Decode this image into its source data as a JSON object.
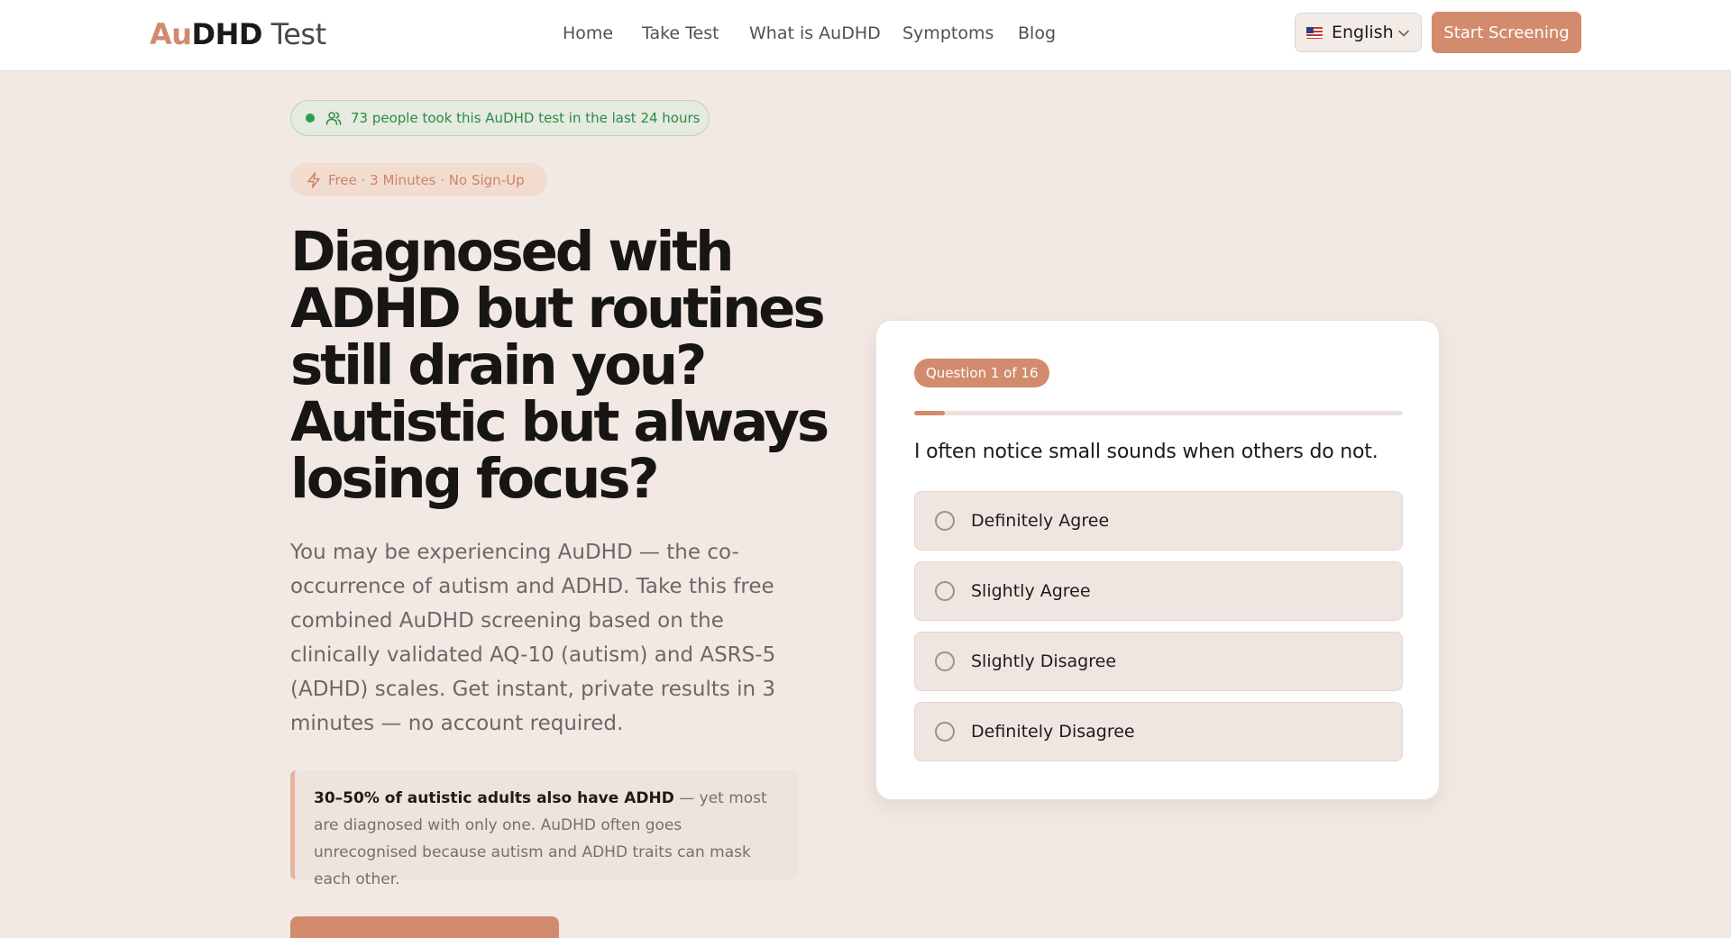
{
  "header": {
    "logo": {
      "part1": "Au",
      "part2": "DHD",
      "part3": "Test"
    },
    "nav": [
      "Home",
      "Take Test",
      "What is AuDHD",
      "Symptoms",
      "Blog"
    ],
    "language": {
      "label": "English",
      "flag_icon": "us-flag-icon"
    },
    "cta_label": "Start Screening"
  },
  "hero": {
    "live_badge": "73 people took this AuDHD test in the last 24 hours",
    "feature_badge": "Free · 3 Minutes · No Sign-Up",
    "title": "Diagnosed with ADHD but routines still drain you? Autistic but always losing focus?",
    "description": "You may be experiencing AuDHD — the co-occurrence of autism and ADHD. Take this free combined AuDHD screening based on the clinically validated AQ-10 (autism) and ASRS-5 (ADHD) scales. Get instant, private results in 3 minutes — no account required.",
    "callout": {
      "bold": "30–50% of autistic adults also have ADHD",
      "rest": " — yet most are diagnosed with only one. AuDHD often goes unrecognised because autism and ADHD traits can mask each other."
    }
  },
  "quiz": {
    "badge": "Question 1 of 16",
    "progress_fraction": 0.0625,
    "question": "I often notice small sounds when others do not.",
    "options": [
      "Definitely Agree",
      "Slightly Agree",
      "Slightly Disagree",
      "Definitely Disagree"
    ]
  },
  "colors": {
    "accent": "#d28b6d",
    "background": "#f2e9e4",
    "live_green": "#2aa04d"
  }
}
